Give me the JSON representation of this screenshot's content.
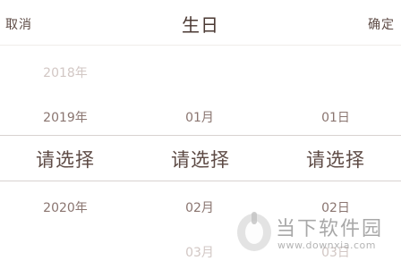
{
  "header": {
    "cancel": "取消",
    "title": "生日",
    "confirm": "确定"
  },
  "year": {
    "above2": "2018年",
    "above1": "2019年",
    "selected": "请选择",
    "below1": "2020年"
  },
  "month": {
    "above1": "01月",
    "selected": "请选择",
    "below1": "02月",
    "below2": "03月"
  },
  "day": {
    "above1": "01日",
    "selected": "请选择",
    "below1": "02日",
    "below2": "03日"
  },
  "watermark": {
    "name": "当下软件园",
    "url": "www.downxia.com"
  }
}
